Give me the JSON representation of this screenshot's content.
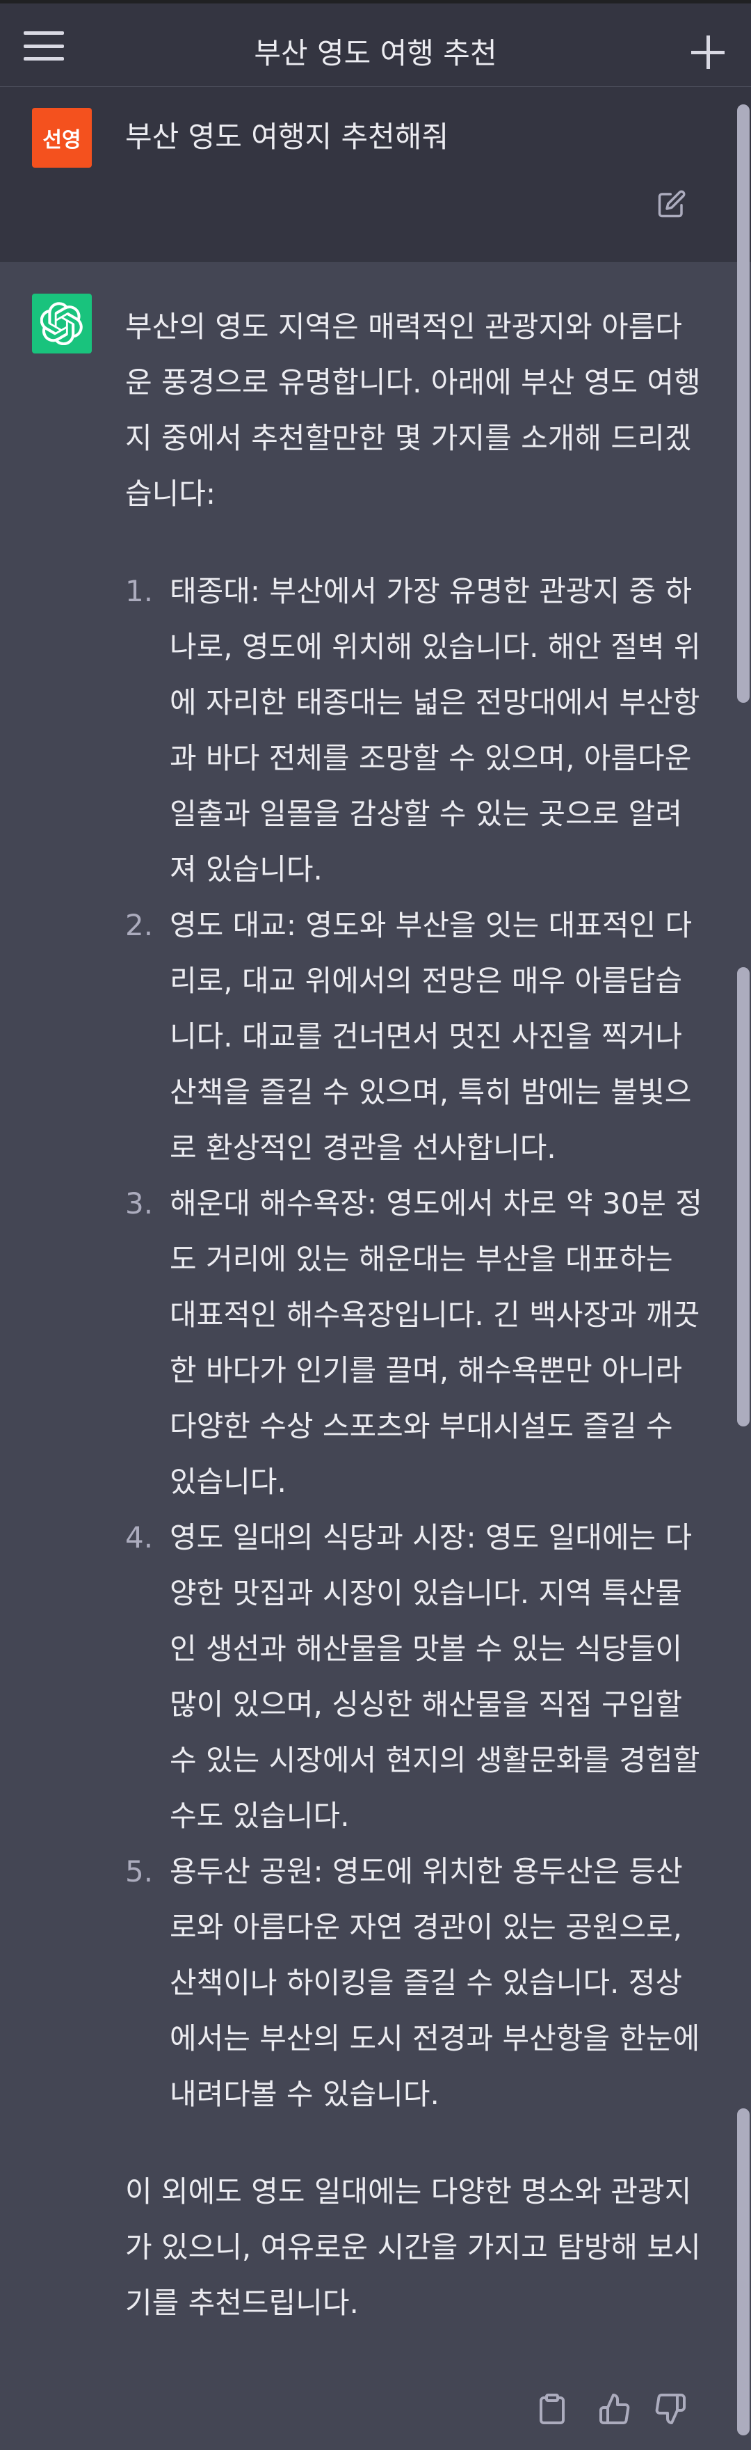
{
  "header": {
    "title": "부산 영도 여행 추천",
    "menu_icon": "hamburger-menu-icon",
    "new_chat_icon": "plus-icon"
  },
  "user_message": {
    "avatar_text": "선영",
    "avatar_color": "#f4511e",
    "text": "부산 영도 여행지 추천해줘",
    "edit_icon": "edit-icon"
  },
  "assistant_message": {
    "avatar_color": "#19c37d",
    "intro": "부산의 영도 지역은 매력적인 관광지와 아름다운 풍경으로 유명합니다. 아래에 부산 영도 여행지 중에서 추천할만한 몇 가지를 소개해 드리겠습니다:",
    "items": [
      {
        "number": "1.",
        "text": "태종대: 부산에서 가장 유명한 관광지 중 하나로, 영도에 위치해 있습니다. 해안 절벽 위에 자리한 태종대는 넓은 전망대에서 부산항과 바다 전체를 조망할 수 있으며, 아름다운 일출과 일몰을 감상할 수 있는 곳으로 알려져 있습니다."
      },
      {
        "number": "2.",
        "text": "영도 대교: 영도와 부산을 잇는 대표적인 다리로, 대교 위에서의 전망은 매우 아름답습니다. 대교를 건너면서 멋진 사진을 찍거나 산책을 즐길 수 있으며, 특히 밤에는 불빛으로 환상적인 경관을 선사합니다."
      },
      {
        "number": "3.",
        "text": "해운대 해수욕장: 영도에서 차로 약 30분 정도 거리에 있는 해운대는 부산을 대표하는 대표적인 해수욕장입니다. 긴 백사장과 깨끗한 바다가 인기를 끌며, 해수욕뿐만 아니라 다양한 수상 스포츠와 부대시설도 즐길 수 있습니다."
      },
      {
        "number": "4.",
        "text": "영도 일대의 식당과 시장: 영도 일대에는 다양한 맛집과 시장이 있습니다. 지역 특산물인 생선과 해산물을 맛볼 수 있는 식당들이 많이 있으며, 싱싱한 해산물을 직접 구입할 수 있는 시장에서 현지의 생활문화를 경험할 수도 있습니다."
      },
      {
        "number": "5.",
        "text": "용두산 공원: 영도에 위치한 용두산은 등산로와 아름다운 자연 경관이 있는 공원으로, 산책이나 하이킹을 즐길 수 있습니다. 정상에서는 부산의 도시 전경과 부산항을 한눈에 내려다볼 수 있습니다."
      }
    ],
    "outro": "이 외에도 영도 일대에는 다양한 명소와 관광지가 있으니, 여유로운 시간을 가지고 탐방해 보시기를 추천드립니다.",
    "actions": [
      "copy-icon",
      "thumbs-up-icon",
      "thumbs-down-icon"
    ]
  },
  "colors": {
    "background": "#444654",
    "header_background": "#343541",
    "text": "#ececf1",
    "muted": "#acacbe"
  }
}
